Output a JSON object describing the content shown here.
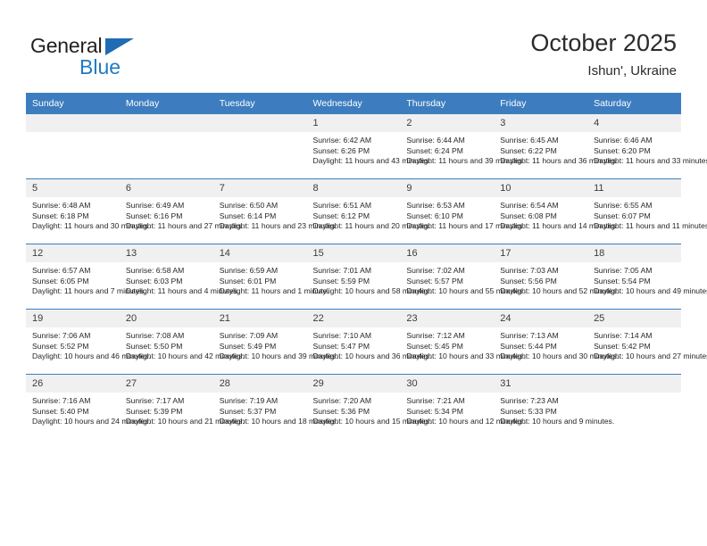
{
  "brand": {
    "name_part1": "General",
    "name_part2": "Blue",
    "triangle_color": "#1f6cb4",
    "text_color": "#231f20",
    "blue_color": "#1f7ac4"
  },
  "header": {
    "title": "October 2025",
    "location": "Ishun', Ukraine"
  },
  "theme": {
    "header_row_bg": "#3d7dbf",
    "daynum_bg": "#f0f0f0",
    "row_divider": "#3d7dbf",
    "cell_bg": "#ffffff"
  },
  "weekdays": [
    "Sunday",
    "Monday",
    "Tuesday",
    "Wednesday",
    "Thursday",
    "Friday",
    "Saturday"
  ],
  "labels": {
    "sunrise": "Sunrise:",
    "sunset": "Sunset:",
    "daylight": "Daylight:"
  },
  "weeks": [
    [
      {
        "day": "",
        "empty": true
      },
      {
        "day": "",
        "empty": true
      },
      {
        "day": "",
        "empty": true
      },
      {
        "day": "1",
        "sunrise": "Sunrise: 6:42 AM",
        "sunset": "Sunset: 6:26 PM",
        "daylight": "Daylight: 11 hours and 43 minutes."
      },
      {
        "day": "2",
        "sunrise": "Sunrise: 6:44 AM",
        "sunset": "Sunset: 6:24 PM",
        "daylight": "Daylight: 11 hours and 39 minutes."
      },
      {
        "day": "3",
        "sunrise": "Sunrise: 6:45 AM",
        "sunset": "Sunset: 6:22 PM",
        "daylight": "Daylight: 11 hours and 36 minutes."
      },
      {
        "day": "4",
        "sunrise": "Sunrise: 6:46 AM",
        "sunset": "Sunset: 6:20 PM",
        "daylight": "Daylight: 11 hours and 33 minutes."
      }
    ],
    [
      {
        "day": "5",
        "sunrise": "Sunrise: 6:48 AM",
        "sunset": "Sunset: 6:18 PM",
        "daylight": "Daylight: 11 hours and 30 minutes."
      },
      {
        "day": "6",
        "sunrise": "Sunrise: 6:49 AM",
        "sunset": "Sunset: 6:16 PM",
        "daylight": "Daylight: 11 hours and 27 minutes."
      },
      {
        "day": "7",
        "sunrise": "Sunrise: 6:50 AM",
        "sunset": "Sunset: 6:14 PM",
        "daylight": "Daylight: 11 hours and 23 minutes."
      },
      {
        "day": "8",
        "sunrise": "Sunrise: 6:51 AM",
        "sunset": "Sunset: 6:12 PM",
        "daylight": "Daylight: 11 hours and 20 minutes."
      },
      {
        "day": "9",
        "sunrise": "Sunrise: 6:53 AM",
        "sunset": "Sunset: 6:10 PM",
        "daylight": "Daylight: 11 hours and 17 minutes."
      },
      {
        "day": "10",
        "sunrise": "Sunrise: 6:54 AM",
        "sunset": "Sunset: 6:08 PM",
        "daylight": "Daylight: 11 hours and 14 minutes."
      },
      {
        "day": "11",
        "sunrise": "Sunrise: 6:55 AM",
        "sunset": "Sunset: 6:07 PM",
        "daylight": "Daylight: 11 hours and 11 minutes."
      }
    ],
    [
      {
        "day": "12",
        "sunrise": "Sunrise: 6:57 AM",
        "sunset": "Sunset: 6:05 PM",
        "daylight": "Daylight: 11 hours and 7 minutes."
      },
      {
        "day": "13",
        "sunrise": "Sunrise: 6:58 AM",
        "sunset": "Sunset: 6:03 PM",
        "daylight": "Daylight: 11 hours and 4 minutes."
      },
      {
        "day": "14",
        "sunrise": "Sunrise: 6:59 AM",
        "sunset": "Sunset: 6:01 PM",
        "daylight": "Daylight: 11 hours and 1 minute."
      },
      {
        "day": "15",
        "sunrise": "Sunrise: 7:01 AM",
        "sunset": "Sunset: 5:59 PM",
        "daylight": "Daylight: 10 hours and 58 minutes."
      },
      {
        "day": "16",
        "sunrise": "Sunrise: 7:02 AM",
        "sunset": "Sunset: 5:57 PM",
        "daylight": "Daylight: 10 hours and 55 minutes."
      },
      {
        "day": "17",
        "sunrise": "Sunrise: 7:03 AM",
        "sunset": "Sunset: 5:56 PM",
        "daylight": "Daylight: 10 hours and 52 minutes."
      },
      {
        "day": "18",
        "sunrise": "Sunrise: 7:05 AM",
        "sunset": "Sunset: 5:54 PM",
        "daylight": "Daylight: 10 hours and 49 minutes."
      }
    ],
    [
      {
        "day": "19",
        "sunrise": "Sunrise: 7:06 AM",
        "sunset": "Sunset: 5:52 PM",
        "daylight": "Daylight: 10 hours and 46 minutes."
      },
      {
        "day": "20",
        "sunrise": "Sunrise: 7:08 AM",
        "sunset": "Sunset: 5:50 PM",
        "daylight": "Daylight: 10 hours and 42 minutes."
      },
      {
        "day": "21",
        "sunrise": "Sunrise: 7:09 AM",
        "sunset": "Sunset: 5:49 PM",
        "daylight": "Daylight: 10 hours and 39 minutes."
      },
      {
        "day": "22",
        "sunrise": "Sunrise: 7:10 AM",
        "sunset": "Sunset: 5:47 PM",
        "daylight": "Daylight: 10 hours and 36 minutes."
      },
      {
        "day": "23",
        "sunrise": "Sunrise: 7:12 AM",
        "sunset": "Sunset: 5:45 PM",
        "daylight": "Daylight: 10 hours and 33 minutes."
      },
      {
        "day": "24",
        "sunrise": "Sunrise: 7:13 AM",
        "sunset": "Sunset: 5:44 PM",
        "daylight": "Daylight: 10 hours and 30 minutes."
      },
      {
        "day": "25",
        "sunrise": "Sunrise: 7:14 AM",
        "sunset": "Sunset: 5:42 PM",
        "daylight": "Daylight: 10 hours and 27 minutes."
      }
    ],
    [
      {
        "day": "26",
        "sunrise": "Sunrise: 7:16 AM",
        "sunset": "Sunset: 5:40 PM",
        "daylight": "Daylight: 10 hours and 24 minutes."
      },
      {
        "day": "27",
        "sunrise": "Sunrise: 7:17 AM",
        "sunset": "Sunset: 5:39 PM",
        "daylight": "Daylight: 10 hours and 21 minutes."
      },
      {
        "day": "28",
        "sunrise": "Sunrise: 7:19 AM",
        "sunset": "Sunset: 5:37 PM",
        "daylight": "Daylight: 10 hours and 18 minutes."
      },
      {
        "day": "29",
        "sunrise": "Sunrise: 7:20 AM",
        "sunset": "Sunset: 5:36 PM",
        "daylight": "Daylight: 10 hours and 15 minutes."
      },
      {
        "day": "30",
        "sunrise": "Sunrise: 7:21 AM",
        "sunset": "Sunset: 5:34 PM",
        "daylight": "Daylight: 10 hours and 12 minutes."
      },
      {
        "day": "31",
        "sunrise": "Sunrise: 7:23 AM",
        "sunset": "Sunset: 5:33 PM",
        "daylight": "Daylight: 10 hours and 9 minutes."
      },
      {
        "day": "",
        "empty": true
      }
    ]
  ]
}
